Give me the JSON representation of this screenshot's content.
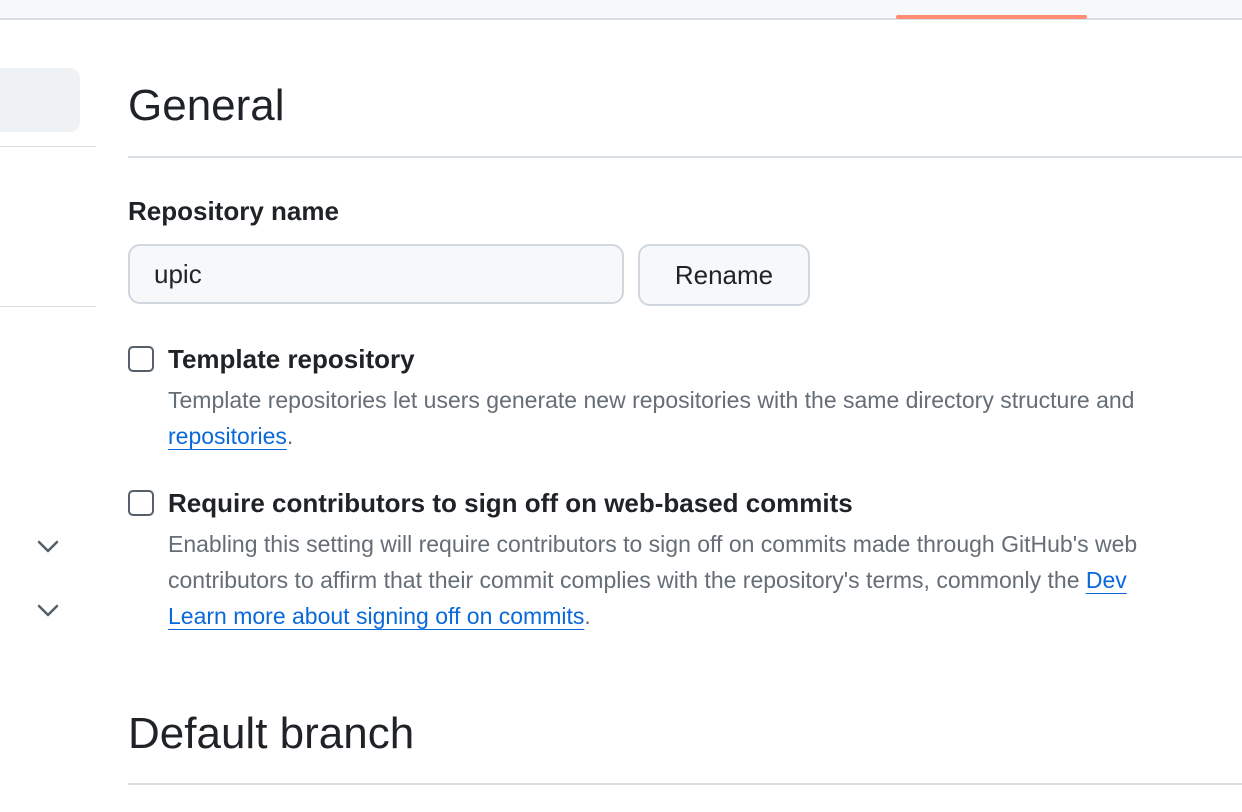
{
  "general": {
    "heading": "General"
  },
  "repo_name": {
    "label": "Repository name",
    "value": "upic",
    "rename_label": "Rename"
  },
  "template": {
    "title": "Template repository",
    "desc_line1": "Template repositories let users generate new repositories with the same directory structure and",
    "link": "repositories",
    "desc_tail": "."
  },
  "signoff": {
    "title": "Require contributors to sign off on web-based commits",
    "desc_line1": "Enabling this setting will require contributors to sign off on commits made through GitHub's web",
    "desc_line2_text": "contributors to affirm that their commit complies with the repository's terms, commonly the ",
    "desc_line2_link": "Dev",
    "learn_more": "Learn more about signing off on commits",
    "learn_tail": "."
  },
  "default_branch": {
    "heading": "Default branch"
  },
  "icons": {
    "chevron1": "chevron-down-icon",
    "chevron2": "chevron-down-icon"
  },
  "colors": {
    "accent": "#fd8c73",
    "link": "#0969da",
    "muted_text": "#656d76",
    "border": "#d0d7de"
  }
}
